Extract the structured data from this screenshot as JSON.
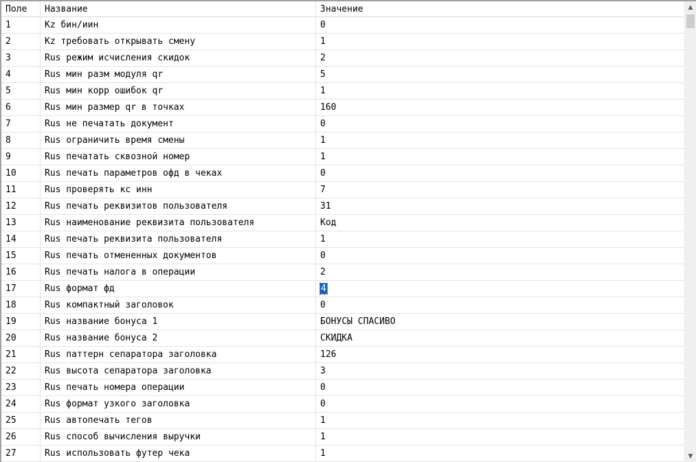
{
  "columns": {
    "field": "Поле",
    "name": "Название",
    "value": "Значение"
  },
  "rows": [
    {
      "field": "1",
      "name": "Kz бин/иин",
      "value": "0"
    },
    {
      "field": "2",
      "name": "Kz требовать открывать смену",
      "value": "1"
    },
    {
      "field": "3",
      "name": "Rus режим исчисления скидок",
      "value": "2"
    },
    {
      "field": "4",
      "name": "Rus мин разм модуля qr",
      "value": "5"
    },
    {
      "field": "5",
      "name": "Rus мин корр ошибок qr",
      "value": "1"
    },
    {
      "field": "6",
      "name": "Rus мин размер qr в точках",
      "value": "160"
    },
    {
      "field": "7",
      "name": "Rus не печатать документ",
      "value": "0"
    },
    {
      "field": "8",
      "name": "Rus ограничить время смены",
      "value": "1"
    },
    {
      "field": "9",
      "name": "Rus печатать сквозной номер",
      "value": "1"
    },
    {
      "field": "10",
      "name": "Rus печать параметров офд в чеках",
      "value": "0"
    },
    {
      "field": "11",
      "name": "Rus проверять кс инн",
      "value": "7"
    },
    {
      "field": "12",
      "name": "Rus печать реквизитов пользователя",
      "value": "31"
    },
    {
      "field": "13",
      "name": "Rus наименование реквизита пользователя",
      "value": "Код"
    },
    {
      "field": "14",
      "name": "Rus печать реквизита пользователя",
      "value": "1"
    },
    {
      "field": "15",
      "name": "Rus печать отмененных документов",
      "value": "0"
    },
    {
      "field": "16",
      "name": "Rus печать налога в операции",
      "value": "2"
    },
    {
      "field": "17",
      "name": "Rus формат фд",
      "value": "4",
      "selected": true
    },
    {
      "field": "18",
      "name": "Rus компактный заголовок",
      "value": "0"
    },
    {
      "field": "19",
      "name": "Rus название бонуса 1",
      "value": "БОНУСЫ СПАСИВО"
    },
    {
      "field": "20",
      "name": "Rus название бонуса 2",
      "value": "СКИДКА"
    },
    {
      "field": "21",
      "name": "Rus паттерн сепаратора заголовка",
      "value": "126"
    },
    {
      "field": "22",
      "name": "Rus высота сепаратора заголовка",
      "value": "3"
    },
    {
      "field": "23",
      "name": "Rus печать номера операции",
      "value": "0"
    },
    {
      "field": "24",
      "name": "Rus формат узкого заголовка",
      "value": "0"
    },
    {
      "field": "25",
      "name": "Rus автопечать тегов",
      "value": "1"
    },
    {
      "field": "26",
      "name": "Rus способ вычисления выручки",
      "value": "1"
    },
    {
      "field": "27",
      "name": "Rus использовать футер чека",
      "value": "1"
    }
  ],
  "scrollbar": {
    "up_icon": "chevron-up-icon",
    "down_icon": "chevron-down-icon"
  },
  "colors": {
    "selection": "#0a64c8",
    "grid_line": "#e4e4e4"
  }
}
